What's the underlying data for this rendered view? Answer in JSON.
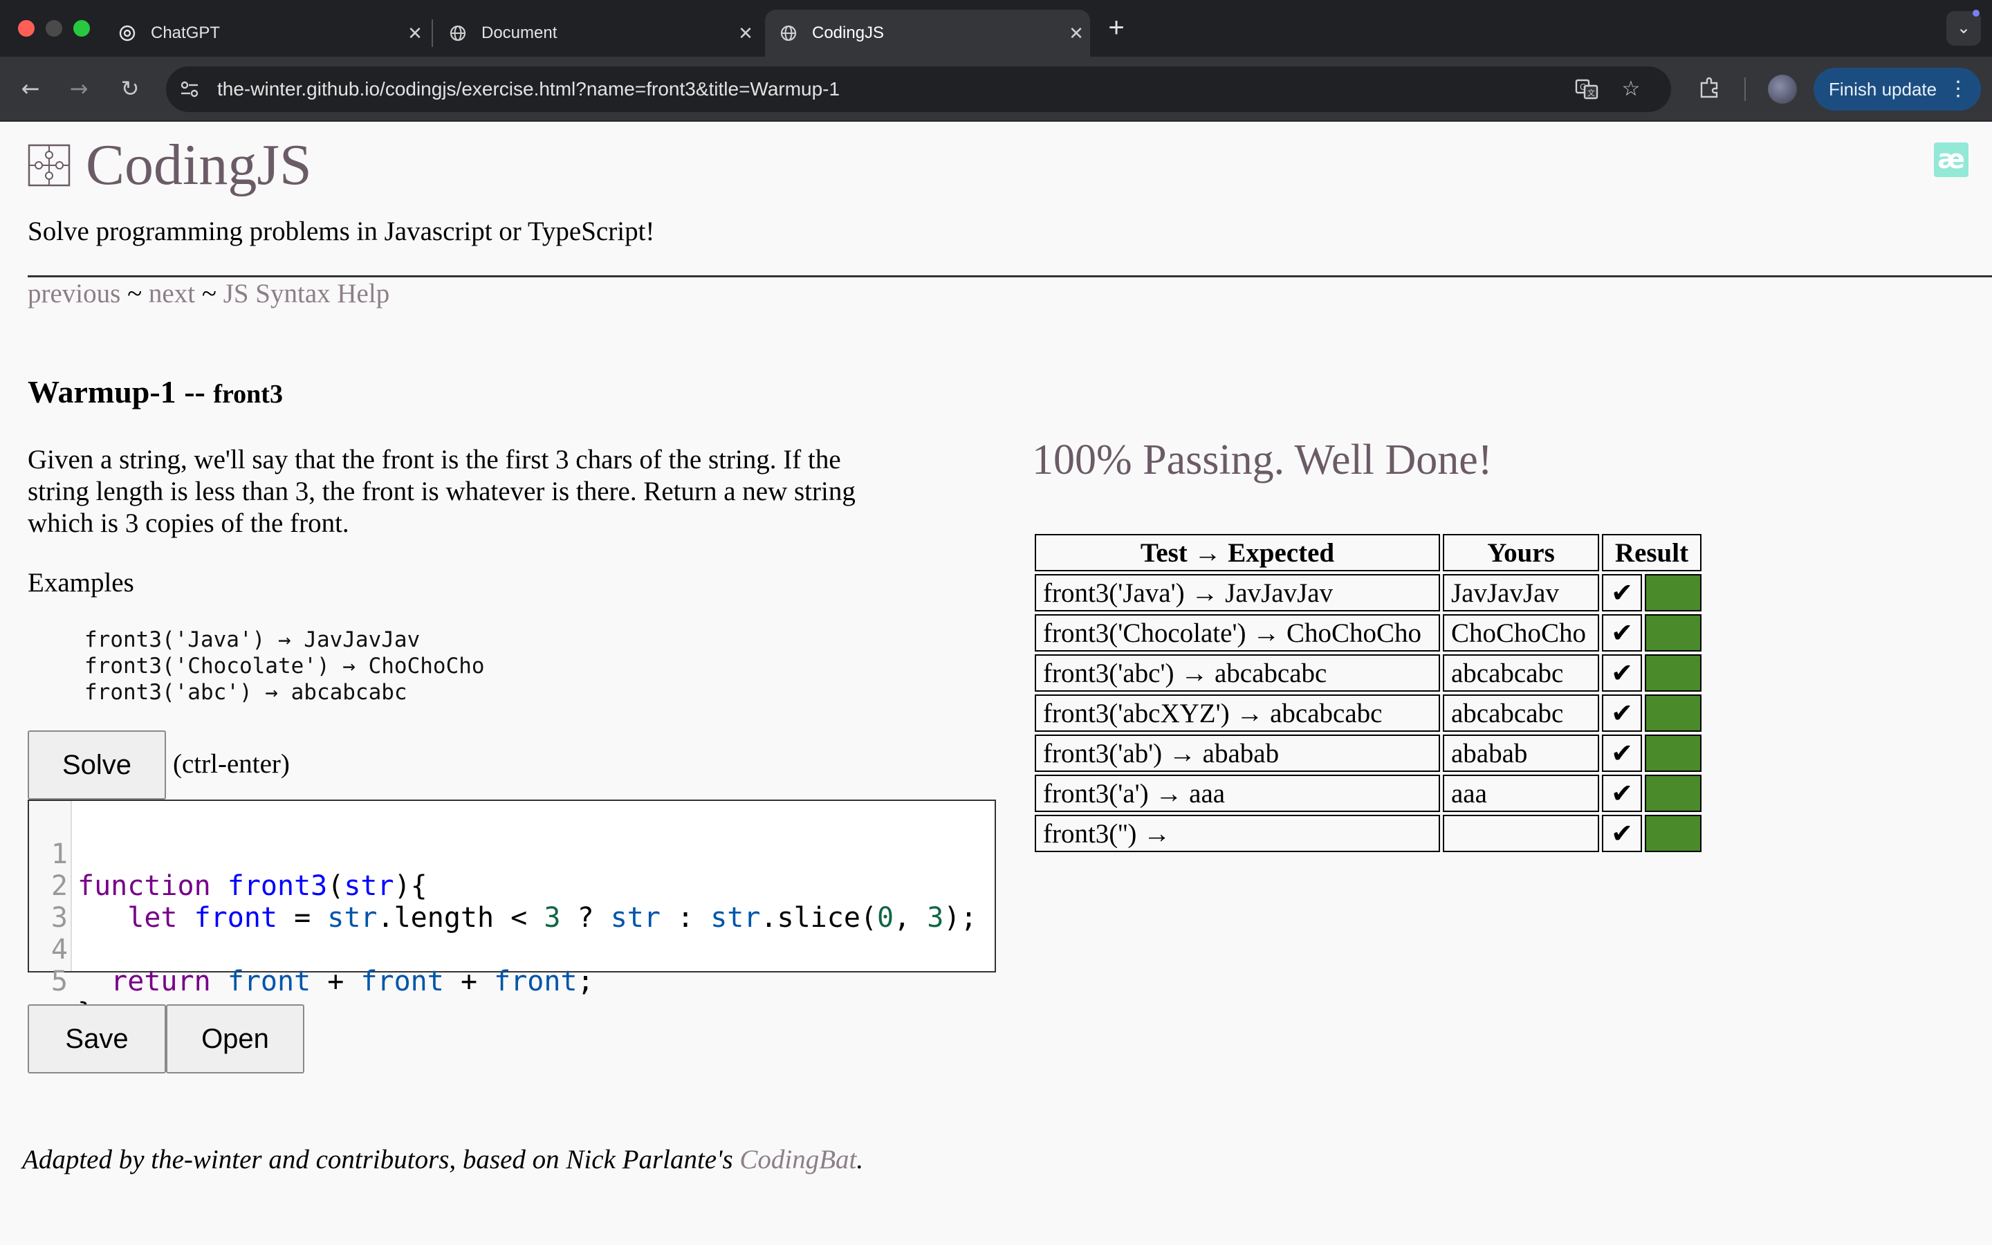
{
  "browser": {
    "tabs": [
      {
        "title": "ChatGPT",
        "icon": "openai-icon",
        "active": false
      },
      {
        "title": "Document",
        "icon": "globe-icon",
        "active": false
      },
      {
        "title": "CodingJS",
        "icon": "globe-icon",
        "active": true
      }
    ],
    "url": "the-winter.github.io/codingjs/exercise.html?name=front3&title=Warmup-1",
    "finish_update_label": "Finish update",
    "new_tab_label": "+",
    "tab_menu_label": "⌄"
  },
  "site": {
    "title": "CodingJS",
    "tagline": "Solve programming problems in Javascript or TypeScript!",
    "ae_badge": "æ",
    "nav": {
      "previous": "previous",
      "sep1": " ~ ",
      "next": "next",
      "sep2": " ~ ",
      "help": "JS Syntax Help"
    }
  },
  "exercise": {
    "category": "Warmup-1",
    "separator": " -- ",
    "name": "front3",
    "description": "Given a string, we'll say that the front is the first 3 chars of the string. If the string length is less than 3, the front is whatever is there. Return a new string which is 3 copies of the front.",
    "examples_label": "Examples",
    "examples": [
      "front3('Java') → JavJavJav",
      "front3('Chocolate') → ChoChoCho",
      "front3('abc') → abcabcabc"
    ],
    "solve_label": "Solve",
    "hint": "(ctrl-enter)",
    "save_label": "Save",
    "open_label": "Open",
    "code_line_numbers": [
      "1",
      "2",
      "3",
      "4",
      "5"
    ]
  },
  "results": {
    "message": "100% Passing. Well Done!",
    "headers": [
      "Test → Expected",
      "Yours",
      "Result"
    ],
    "rows": [
      {
        "test": "front3('Java') → JavJavJav",
        "yours": "JavJavJav",
        "mark": "✔",
        "status": "pass"
      },
      {
        "test": "front3('Chocolate') → ChoChoCho",
        "yours": "ChoChoCho",
        "mark": "✔",
        "status": "pass"
      },
      {
        "test": "front3('abc') → abcabcabc",
        "yours": "abcabcabc",
        "mark": "✔",
        "status": "pass"
      },
      {
        "test": "front3('abcXYZ') → abcabcabc",
        "yours": "abcabcabc",
        "mark": "✔",
        "status": "pass"
      },
      {
        "test": "front3('ab') → ababab",
        "yours": "ababab",
        "mark": "✔",
        "status": "pass"
      },
      {
        "test": "front3('a') → aaa",
        "yours": "aaa",
        "mark": "✔",
        "status": "pass"
      },
      {
        "test": "front3('') →",
        "yours": "",
        "mark": "✔",
        "status": "pass"
      }
    ],
    "pass_color": "#4a8a2a"
  },
  "footer": {
    "text": "Adapted by the-winter and contributors, based on Nick Parlante's ",
    "link": "CodingBat",
    "end": "."
  },
  "colors": {
    "title": "#6b5b66",
    "link": "#8c7f88",
    "chrome_dark": "#202124",
    "chrome_toolbar": "#35363a",
    "update_button": "#1c4d80"
  }
}
